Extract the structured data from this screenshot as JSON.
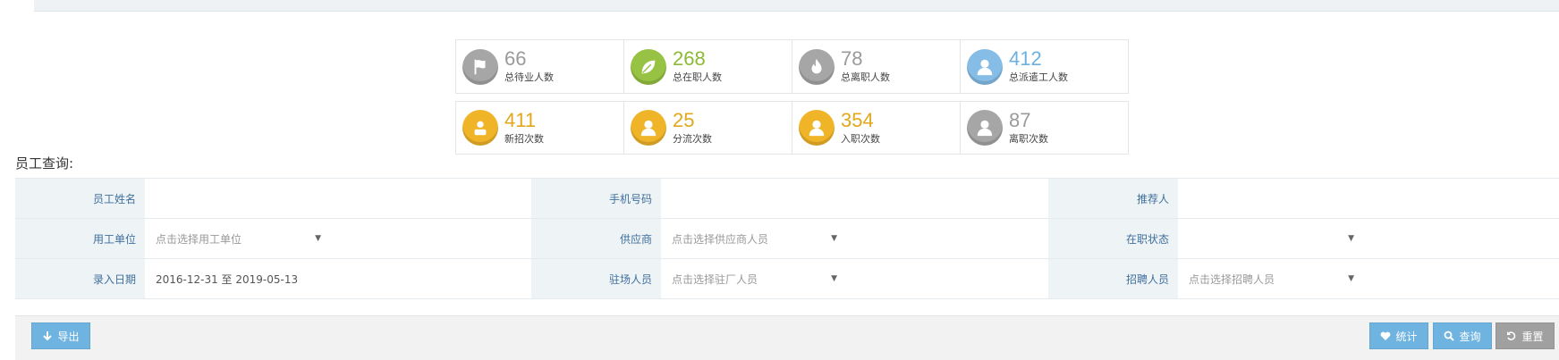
{
  "stats": [
    {
      "value": "66",
      "label": "总待业人数",
      "icon": "flag-icon",
      "color": "gray"
    },
    {
      "value": "268",
      "label": "总在职人数",
      "icon": "leaf-icon",
      "color": "green"
    },
    {
      "value": "78",
      "label": "总离职人数",
      "icon": "fire-icon",
      "color": "gray"
    },
    {
      "value": "412",
      "label": "总派遣工人数",
      "icon": "user-icon",
      "color": "blue"
    },
    {
      "value": "411",
      "label": "新招次数",
      "icon": "user-icon",
      "color": "orange"
    },
    {
      "value": "25",
      "label": "分流次数",
      "icon": "user-icon",
      "color": "orange"
    },
    {
      "value": "354",
      "label": "入职次数",
      "icon": "user-icon",
      "color": "orange"
    },
    {
      "value": "87",
      "label": "离职次数",
      "icon": "user-icon",
      "color": "gray"
    }
  ],
  "section_title": "员工查询:",
  "form": {
    "name_label": "员工姓名",
    "phone_label": "手机号码",
    "referrer_label": "推荐人",
    "employer_label": "用工单位",
    "employer_placeholder": "点击选择用工单位",
    "supplier_label": "供应商",
    "supplier_placeholder": "点击选择供应商人员",
    "status_label": "在职状态",
    "status_value": "",
    "date_label": "录入日期",
    "date_value": "2016-12-31 至 2019-05-13",
    "onsite_label": "驻场人员",
    "onsite_placeholder": "点击选择驻厂人员",
    "recruiter_label": "招聘人员",
    "recruiter_placeholder": "点击选择招聘人员"
  },
  "toolbar": {
    "export_label": "导出",
    "stat_label": "统计",
    "query_label": "查询",
    "reset_label": "重置"
  },
  "colors": {
    "gray": "#a6a6a6",
    "green": "#97c243",
    "blue": "#86bde6",
    "orange": "#f0b429",
    "button_blue": "#6fb3e0",
    "button_gray": "#a0a0a0",
    "label_text": "#3f6f9c"
  }
}
